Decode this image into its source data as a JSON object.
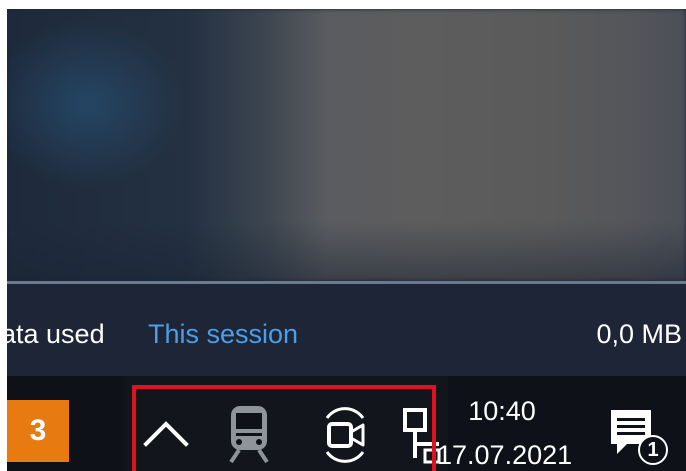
{
  "step_badge": "3",
  "stats": {
    "label": "Data used",
    "label_visible": "ata used",
    "period": "This session",
    "value": "0,0 MB"
  },
  "tray": {
    "icons": [
      "chevron-up-icon",
      "train-icon",
      "camera-icon",
      "network-icon"
    ]
  },
  "clock": {
    "time": "10:40",
    "date": "17.07.2021",
    "date_visible": "17.07.2021"
  },
  "notifications": {
    "count": "1"
  },
  "colors": {
    "highlight": "#e0121f",
    "badge": "#e87a12",
    "link": "#4a9fe8",
    "taskbar": "#0e1117"
  }
}
